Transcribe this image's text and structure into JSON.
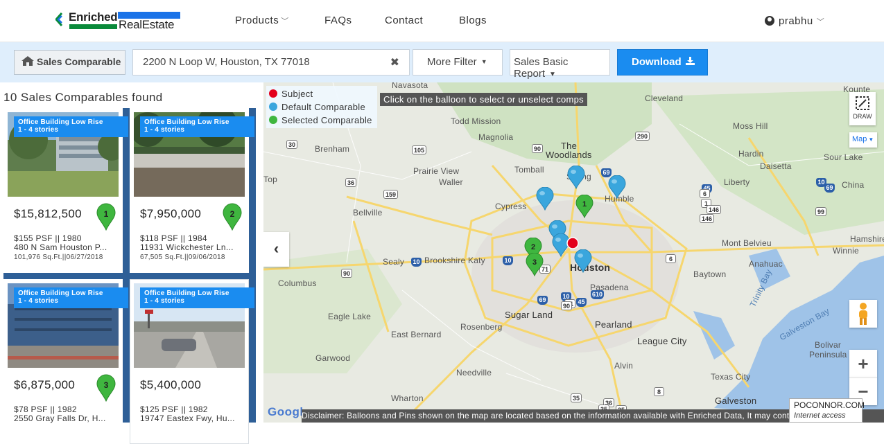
{
  "brand": {
    "line1": "Enriched",
    "line2": "RealEstate"
  },
  "nav": [
    {
      "label": "Products",
      "has_menu": true
    },
    {
      "label": "FAQs",
      "has_menu": false
    },
    {
      "label": "Contact",
      "has_menu": false
    },
    {
      "label": "Blogs",
      "has_menu": false
    }
  ],
  "user": {
    "name": "prabhu"
  },
  "toolbar": {
    "mode_label": "Sales Comparable",
    "address_value": "2200 N Loop W, Houston, TX 77018",
    "clear_icon": "close-icon",
    "more_filter_label": "More Filter",
    "report_selected": "Sales Basic Report",
    "download_label": "Download"
  },
  "results": {
    "count_text": "10 Sales Comparables found",
    "cards": [
      {
        "type": "Office Building Low Rise",
        "subtype": "1 - 4 stories",
        "price": "$15,812,500",
        "psf_year": "$155 PSF || 1980",
        "address": "480 N Sam Houston P...",
        "sqft_date": "101,976 Sq.Ft.||06/27/2018",
        "pin_number": "1",
        "selected": true
      },
      {
        "type": "Office Building Low Rise",
        "subtype": "1 - 4 stories",
        "price": "$7,950,000",
        "psf_year": "$118 PSF || 1984",
        "address": "11931 Wickchester Ln...",
        "sqft_date": "67,505 Sq.Ft.||09/06/2018",
        "pin_number": "2",
        "selected": true
      },
      {
        "type": "Office Building Low Rise",
        "subtype": "1 - 4 stories",
        "price": "$6,875,000",
        "psf_year": "$78 PSF || 1982",
        "address": "2550 Gray Falls Dr, H...",
        "sqft_date": "",
        "pin_number": "3",
        "selected": true
      },
      {
        "type": "Office Building Low Rise",
        "subtype": "1 - 4 stories",
        "price": "$5,400,000",
        "psf_year": "$125 PSF || 1982",
        "address": "19747 Eastex Fwy, Hu...",
        "sqft_date": "",
        "pin_number": "",
        "selected": false
      }
    ]
  },
  "map": {
    "legend": [
      {
        "label": "Subject",
        "color": "#e3001b"
      },
      {
        "label": "Default Comparable",
        "color": "#3aa6dd"
      },
      {
        "label": "Selected Comparable",
        "color": "#3fb63f"
      }
    ],
    "hint": "Click on the balloon to select or unselect comps",
    "draw_label": "DRAW",
    "map_type": "Map",
    "zoom_in": "+",
    "zoom_out": "−",
    "collapse": "‹",
    "google": "Google",
    "disclaimer": "Disclaimer: Balloons and Pins shown on the map are located based on the information available with Enriched Data, It may contain some",
    "badge_line1": "POCONNOR.COM",
    "badge_line2": "Internet access",
    "labels": [
      {
        "text": "Navasota",
        "cls": ""
      },
      {
        "text": "Cleveland",
        "cls": ""
      },
      {
        "text": "Todd Mission",
        "cls": ""
      },
      {
        "text": "Moss Hill",
        "cls": ""
      },
      {
        "text": "Magnolia",
        "cls": ""
      },
      {
        "text": "The",
        "cls": "mid"
      },
      {
        "text": "Woodlands",
        "cls": "mid"
      },
      {
        "text": "Brenham",
        "cls": ""
      },
      {
        "text": "Hardin",
        "cls": ""
      },
      {
        "text": "Daisetta",
        "cls": ""
      },
      {
        "text": "Sour Lake",
        "cls": ""
      },
      {
        "text": "Prairie View",
        "cls": ""
      },
      {
        "text": "Tomball",
        "cls": ""
      },
      {
        "text": "Spring",
        "cls": ""
      },
      {
        "text": "Waller",
        "cls": ""
      },
      {
        "text": "Humble",
        "cls": ""
      },
      {
        "text": "Liberty",
        "cls": ""
      },
      {
        "text": "China",
        "cls": ""
      },
      {
        "text": "Top",
        "cls": ""
      },
      {
        "text": "Bellville",
        "cls": ""
      },
      {
        "text": "Cypress",
        "cls": ""
      },
      {
        "text": "Mont Belvieu",
        "cls": ""
      },
      {
        "text": "Winnie",
        "cls": ""
      },
      {
        "text": "Hamshire",
        "cls": ""
      },
      {
        "text": "Sealy",
        "cls": ""
      },
      {
        "text": "Brookshire",
        "cls": ""
      },
      {
        "text": "Katy",
        "cls": ""
      },
      {
        "text": "Houston",
        "cls": "big"
      },
      {
        "text": "Anahuac",
        "cls": ""
      },
      {
        "text": "Columbus",
        "cls": ""
      },
      {
        "text": "Baytown",
        "cls": ""
      },
      {
        "text": "Pasadena",
        "cls": ""
      },
      {
        "text": "Trinity Bay",
        "cls": ""
      },
      {
        "text": "Eagle Lake",
        "cls": ""
      },
      {
        "text": "Sugar Land",
        "cls": "mid"
      },
      {
        "text": "Rosenberg",
        "cls": ""
      },
      {
        "text": "Pearland",
        "cls": "mid"
      },
      {
        "text": "East Bernard",
        "cls": ""
      },
      {
        "text": "League City",
        "cls": "mid"
      },
      {
        "text": "Galveston Bay",
        "cls": ""
      },
      {
        "text": "Bolivar",
        "cls": ""
      },
      {
        "text": "Peninsula",
        "cls": ""
      },
      {
        "text": "Garwood",
        "cls": ""
      },
      {
        "text": "Alvin",
        "cls": ""
      },
      {
        "text": "Needville",
        "cls": ""
      },
      {
        "text": "Texas City",
        "cls": ""
      },
      {
        "text": "Wharton",
        "cls": ""
      },
      {
        "text": "Galveston",
        "cls": "mid"
      },
      {
        "text": "Kounte",
        "cls": ""
      }
    ],
    "pins": [
      {
        "kind": "default",
        "label": ""
      },
      {
        "kind": "default",
        "label": ""
      },
      {
        "kind": "default",
        "label": ""
      },
      {
        "kind": "selected",
        "label": "1"
      },
      {
        "kind": "default",
        "label": ""
      },
      {
        "kind": "default",
        "label": ""
      },
      {
        "kind": "default",
        "label": ""
      },
      {
        "kind": "selected",
        "label": "2"
      },
      {
        "kind": "selected",
        "label": "3"
      },
      {
        "kind": "default",
        "label": ""
      },
      {
        "kind": "subject",
        "label": ""
      }
    ],
    "shields": [
      "30",
      "105",
      "90",
      "36",
      "290",
      "159",
      "69",
      "45",
      "6",
      "10",
      "99",
      "69",
      "1",
      "146",
      "146",
      "10",
      "90",
      "10",
      "71",
      "10",
      "71",
      "610",
      "69",
      "45",
      "6",
      "90",
      "8",
      "35",
      "36",
      "35",
      "35"
    ]
  }
}
